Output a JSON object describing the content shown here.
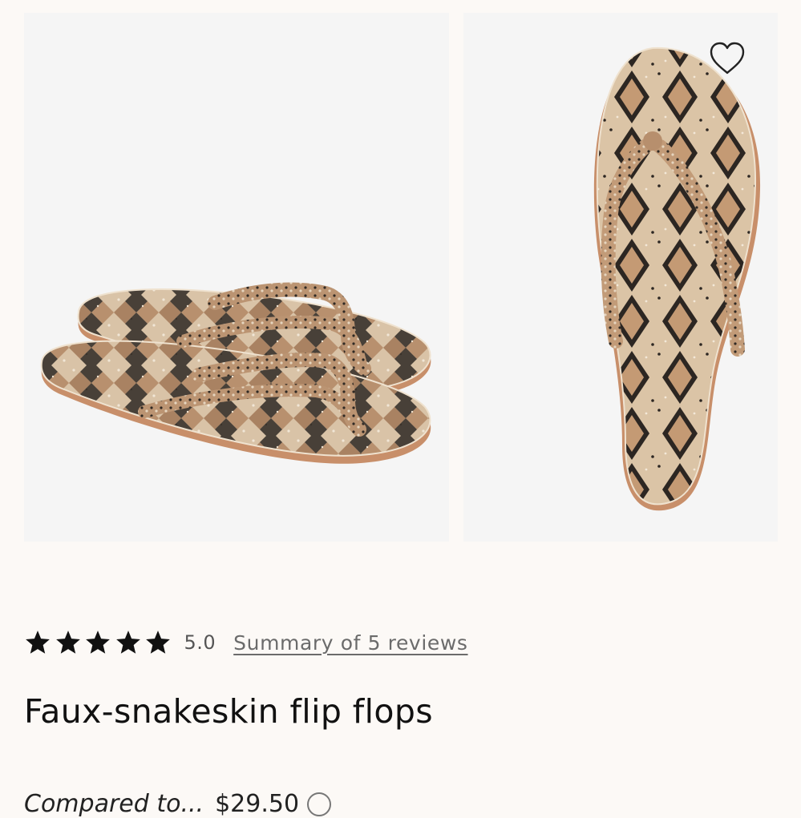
{
  "gallery": {
    "images": [
      {
        "alt": "Faux-snakeskin flip flops pair, side view"
      },
      {
        "alt": "Faux-snakeskin flip flop, top view"
      }
    ],
    "favorite_icon": "heart-outline-icon"
  },
  "rating": {
    "stars": 5,
    "score": "5.0",
    "reviews_link": "Summary of 5 reviews",
    "star_color": "#111111"
  },
  "product": {
    "title": "Faux-snakeskin flip flops"
  },
  "price": {
    "label": "Compared to...",
    "value": "$29.50"
  },
  "colors": {
    "background": "#fcf9f6",
    "photo_background": "#f5f5f5",
    "snake_tan": "#c9a27e",
    "snake_dark": "#2b2622",
    "sole_edge": "#c88f6a"
  }
}
